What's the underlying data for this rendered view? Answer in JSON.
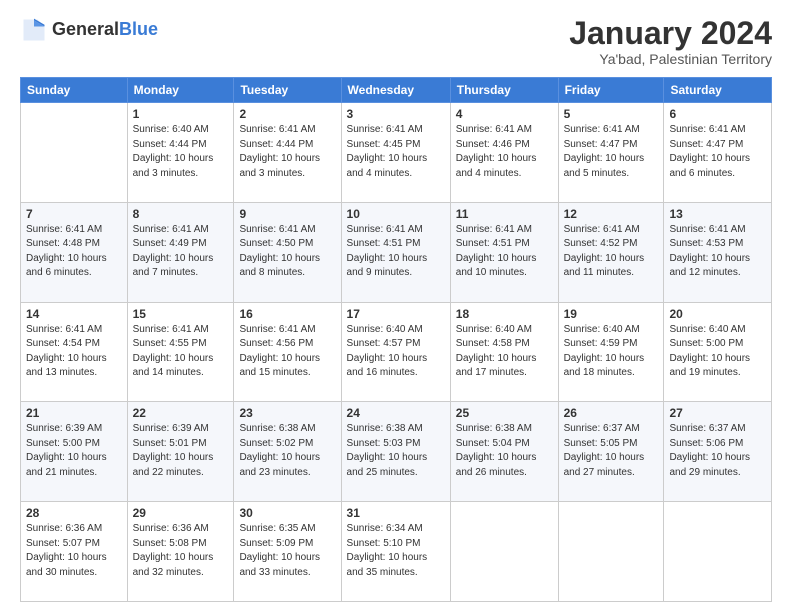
{
  "header": {
    "logo_line1": "General",
    "logo_line2": "Blue",
    "month_title": "January 2024",
    "location": "Ya'bad, Palestinian Territory"
  },
  "weekdays": [
    "Sunday",
    "Monday",
    "Tuesday",
    "Wednesday",
    "Thursday",
    "Friday",
    "Saturday"
  ],
  "weeks": [
    [
      {
        "day": "",
        "sunrise": "",
        "sunset": "",
        "daylight": ""
      },
      {
        "day": "1",
        "sunrise": "Sunrise: 6:40 AM",
        "sunset": "Sunset: 4:44 PM",
        "daylight": "Daylight: 10 hours and 3 minutes."
      },
      {
        "day": "2",
        "sunrise": "Sunrise: 6:41 AM",
        "sunset": "Sunset: 4:44 PM",
        "daylight": "Daylight: 10 hours and 3 minutes."
      },
      {
        "day": "3",
        "sunrise": "Sunrise: 6:41 AM",
        "sunset": "Sunset: 4:45 PM",
        "daylight": "Daylight: 10 hours and 4 minutes."
      },
      {
        "day": "4",
        "sunrise": "Sunrise: 6:41 AM",
        "sunset": "Sunset: 4:46 PM",
        "daylight": "Daylight: 10 hours and 4 minutes."
      },
      {
        "day": "5",
        "sunrise": "Sunrise: 6:41 AM",
        "sunset": "Sunset: 4:47 PM",
        "daylight": "Daylight: 10 hours and 5 minutes."
      },
      {
        "day": "6",
        "sunrise": "Sunrise: 6:41 AM",
        "sunset": "Sunset: 4:47 PM",
        "daylight": "Daylight: 10 hours and 6 minutes."
      }
    ],
    [
      {
        "day": "7",
        "sunrise": "Sunrise: 6:41 AM",
        "sunset": "Sunset: 4:48 PM",
        "daylight": "Daylight: 10 hours and 6 minutes."
      },
      {
        "day": "8",
        "sunrise": "Sunrise: 6:41 AM",
        "sunset": "Sunset: 4:49 PM",
        "daylight": "Daylight: 10 hours and 7 minutes."
      },
      {
        "day": "9",
        "sunrise": "Sunrise: 6:41 AM",
        "sunset": "Sunset: 4:50 PM",
        "daylight": "Daylight: 10 hours and 8 minutes."
      },
      {
        "day": "10",
        "sunrise": "Sunrise: 6:41 AM",
        "sunset": "Sunset: 4:51 PM",
        "daylight": "Daylight: 10 hours and 9 minutes."
      },
      {
        "day": "11",
        "sunrise": "Sunrise: 6:41 AM",
        "sunset": "Sunset: 4:51 PM",
        "daylight": "Daylight: 10 hours and 10 minutes."
      },
      {
        "day": "12",
        "sunrise": "Sunrise: 6:41 AM",
        "sunset": "Sunset: 4:52 PM",
        "daylight": "Daylight: 10 hours and 11 minutes."
      },
      {
        "day": "13",
        "sunrise": "Sunrise: 6:41 AM",
        "sunset": "Sunset: 4:53 PM",
        "daylight": "Daylight: 10 hours and 12 minutes."
      }
    ],
    [
      {
        "day": "14",
        "sunrise": "Sunrise: 6:41 AM",
        "sunset": "Sunset: 4:54 PM",
        "daylight": "Daylight: 10 hours and 13 minutes."
      },
      {
        "day": "15",
        "sunrise": "Sunrise: 6:41 AM",
        "sunset": "Sunset: 4:55 PM",
        "daylight": "Daylight: 10 hours and 14 minutes."
      },
      {
        "day": "16",
        "sunrise": "Sunrise: 6:41 AM",
        "sunset": "Sunset: 4:56 PM",
        "daylight": "Daylight: 10 hours and 15 minutes."
      },
      {
        "day": "17",
        "sunrise": "Sunrise: 6:40 AM",
        "sunset": "Sunset: 4:57 PM",
        "daylight": "Daylight: 10 hours and 16 minutes."
      },
      {
        "day": "18",
        "sunrise": "Sunrise: 6:40 AM",
        "sunset": "Sunset: 4:58 PM",
        "daylight": "Daylight: 10 hours and 17 minutes."
      },
      {
        "day": "19",
        "sunrise": "Sunrise: 6:40 AM",
        "sunset": "Sunset: 4:59 PM",
        "daylight": "Daylight: 10 hours and 18 minutes."
      },
      {
        "day": "20",
        "sunrise": "Sunrise: 6:40 AM",
        "sunset": "Sunset: 5:00 PM",
        "daylight": "Daylight: 10 hours and 19 minutes."
      }
    ],
    [
      {
        "day": "21",
        "sunrise": "Sunrise: 6:39 AM",
        "sunset": "Sunset: 5:00 PM",
        "daylight": "Daylight: 10 hours and 21 minutes."
      },
      {
        "day": "22",
        "sunrise": "Sunrise: 6:39 AM",
        "sunset": "Sunset: 5:01 PM",
        "daylight": "Daylight: 10 hours and 22 minutes."
      },
      {
        "day": "23",
        "sunrise": "Sunrise: 6:38 AM",
        "sunset": "Sunset: 5:02 PM",
        "daylight": "Daylight: 10 hours and 23 minutes."
      },
      {
        "day": "24",
        "sunrise": "Sunrise: 6:38 AM",
        "sunset": "Sunset: 5:03 PM",
        "daylight": "Daylight: 10 hours and 25 minutes."
      },
      {
        "day": "25",
        "sunrise": "Sunrise: 6:38 AM",
        "sunset": "Sunset: 5:04 PM",
        "daylight": "Daylight: 10 hours and 26 minutes."
      },
      {
        "day": "26",
        "sunrise": "Sunrise: 6:37 AM",
        "sunset": "Sunset: 5:05 PM",
        "daylight": "Daylight: 10 hours and 27 minutes."
      },
      {
        "day": "27",
        "sunrise": "Sunrise: 6:37 AM",
        "sunset": "Sunset: 5:06 PM",
        "daylight": "Daylight: 10 hours and 29 minutes."
      }
    ],
    [
      {
        "day": "28",
        "sunrise": "Sunrise: 6:36 AM",
        "sunset": "Sunset: 5:07 PM",
        "daylight": "Daylight: 10 hours and 30 minutes."
      },
      {
        "day": "29",
        "sunrise": "Sunrise: 6:36 AM",
        "sunset": "Sunset: 5:08 PM",
        "daylight": "Daylight: 10 hours and 32 minutes."
      },
      {
        "day": "30",
        "sunrise": "Sunrise: 6:35 AM",
        "sunset": "Sunset: 5:09 PM",
        "daylight": "Daylight: 10 hours and 33 minutes."
      },
      {
        "day": "31",
        "sunrise": "Sunrise: 6:34 AM",
        "sunset": "Sunset: 5:10 PM",
        "daylight": "Daylight: 10 hours and 35 minutes."
      },
      {
        "day": "",
        "sunrise": "",
        "sunset": "",
        "daylight": ""
      },
      {
        "day": "",
        "sunrise": "",
        "sunset": "",
        "daylight": ""
      },
      {
        "day": "",
        "sunrise": "",
        "sunset": "",
        "daylight": ""
      }
    ]
  ]
}
